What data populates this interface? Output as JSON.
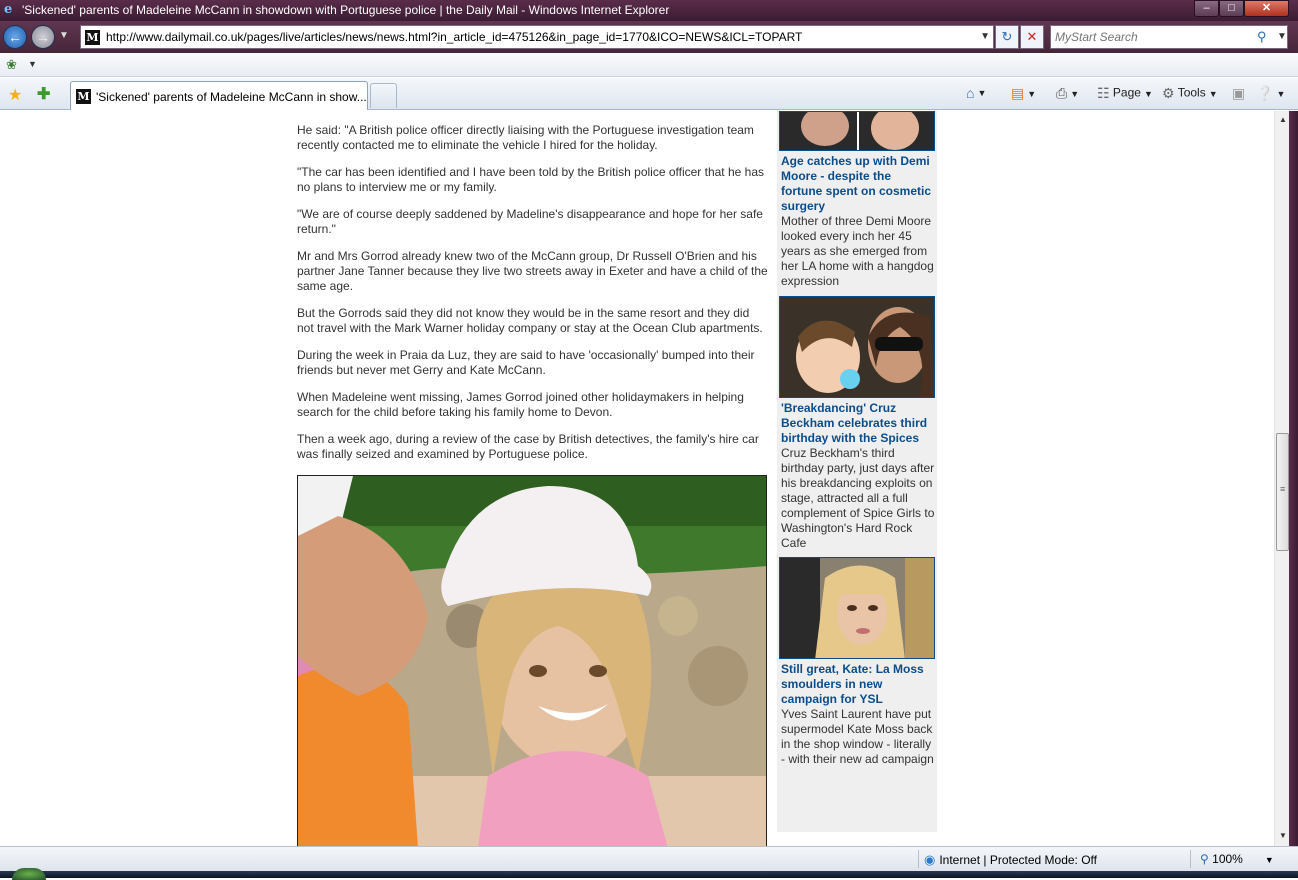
{
  "window": {
    "title": "'Sickened' parents of Madeleine McCann in showdown with Portuguese police | the Daily Mail - Windows Internet Explorer",
    "minimize": "–",
    "maximize": "□",
    "close": "✕"
  },
  "nav": {
    "back_icon": "back-arrow-icon",
    "forward_icon": "forward-arrow-icon",
    "url": "http://www.dailymail.co.uk/pages/live/articles/news/news.html?in_article_id=475126&in_page_id=1770&ICO=NEWS&ICL=TOPART",
    "search_placeholder": "MyStart Search"
  },
  "tabs": [
    {
      "label": "'Sickened' parents of Madeleine McCann in show..."
    }
  ],
  "commandbar": {
    "page_label": "Page",
    "tools_label": "Tools"
  },
  "article": {
    "paragraphs": [
      "He said: \"A British police officer directly liaising with the Portuguese investigation team recently contacted me to eliminate the vehicle I hired for the holiday.",
      "\"The car has been identified and I have been told by the British police officer that he has no plans to interview me or my family.",
      "\"We are of course deeply saddened by Madeline's disappearance and hope for her safe return.\"",
      "Mr and Mrs Gorrod already knew two of the McCann group, Dr Russell O'Brien and his partner Jane Tanner because they live two streets away in Exeter and have a child of the same age.",
      "But the Gorrods said they did not know they would be in the same resort and they did not travel with the Mark Warner holiday company or stay at the Ocean Club apartments.",
      "During the week in Praia da Luz, they are said to have 'occasionally' bumped into their friends but never met Gerry and Kate McCann.",
      "When Madeleine went missing, James Gorrod joined other holidaymakers in helping search for the child before taking his family home to Devon.",
      "Then a week ago, during a review of the case by British detectives, the family's hire car was finally seized and examined by Portuguese police."
    ]
  },
  "sidebar": {
    "stories": [
      {
        "headline": "Age catches up with Demi Moore - despite the fortune spent on cosmetic surgery",
        "blurb": "Mother of three Demi Moore looked every inch her 45 years as she emerged from her LA home with a hangdog expression"
      },
      {
        "headline": "'Breakdancing' Cruz Beckham celebrates third birthday with the Spices",
        "blurb": "Cruz Beckham's third birthday party, just days after his breakdancing exploits on stage, attracted all a full complement of Spice Girls to Washington's Hard Rock Cafe"
      },
      {
        "headline": "Still great, Kate: La Moss smoulders in new campaign for YSL",
        "blurb": "Yves Saint Laurent have put supermodel Kate Moss back in the shop window - literally - with their new ad campaign"
      }
    ]
  },
  "status": {
    "zone": "Internet | Protected Mode: Off",
    "zoom": "100%"
  },
  "colors": {
    "title_bar": "#4a2340",
    "headline_link": "#0a4d8c",
    "sidebar_bg": "#efefef"
  }
}
